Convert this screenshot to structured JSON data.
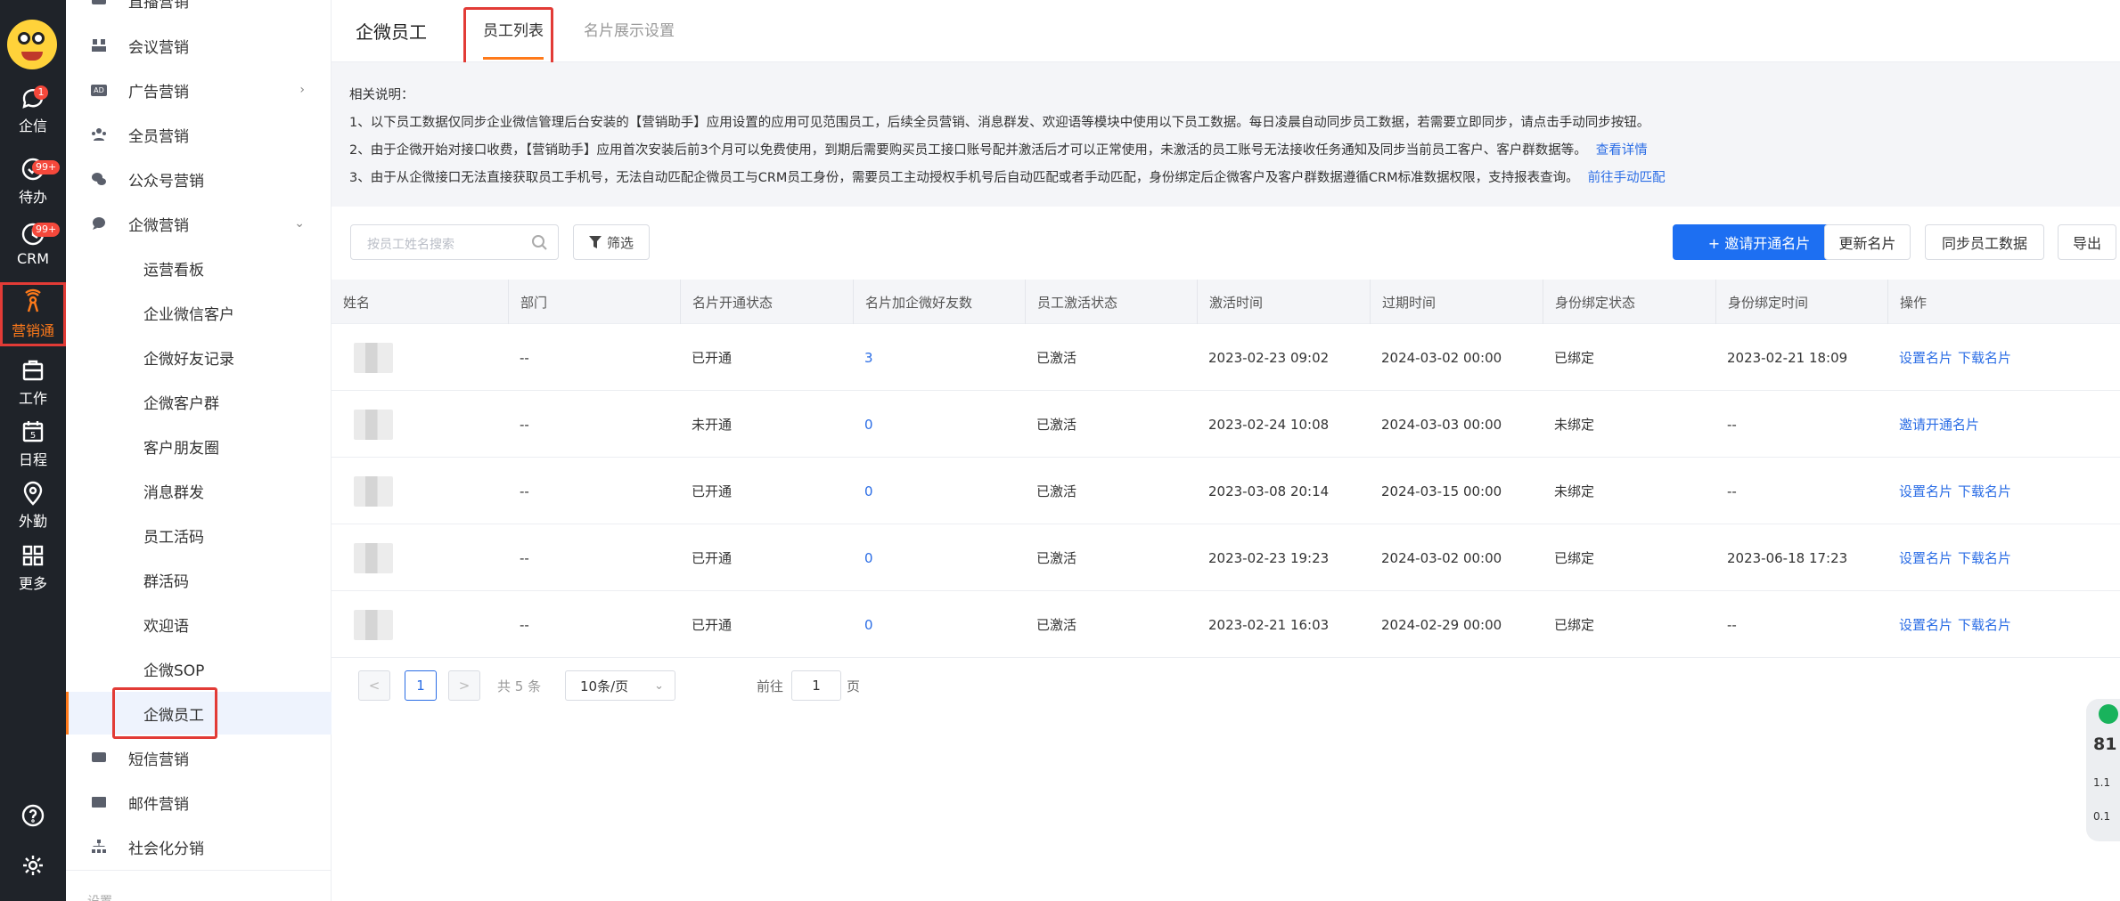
{
  "rail": {
    "items": [
      {
        "label": "企信",
        "badge": "1"
      },
      {
        "label": "待办",
        "badge": "99+"
      },
      {
        "label": "CRM",
        "badge": "99+"
      },
      {
        "label": "营销通",
        "badge": ""
      },
      {
        "label": "工作",
        "badge": ""
      },
      {
        "label": "日程",
        "badge": ""
      },
      {
        "label": "外勤",
        "badge": ""
      },
      {
        "label": "更多",
        "badge": ""
      }
    ],
    "calendar_day": "5",
    "help_icon": "help-icon",
    "settings_icon": "settings-icon"
  },
  "menu": {
    "items": [
      {
        "label": "直播营销"
      },
      {
        "label": "会议营销"
      },
      {
        "label": "广告营销"
      },
      {
        "label": "全员营销"
      },
      {
        "label": "公众号营销"
      },
      {
        "label": "企微营销"
      },
      {
        "label": "运营看板"
      },
      {
        "label": "企业微信客户"
      },
      {
        "label": "企微好友记录"
      },
      {
        "label": "企微客户群"
      },
      {
        "label": "客户朋友圈"
      },
      {
        "label": "消息群发"
      },
      {
        "label": "员工活码"
      },
      {
        "label": "群活码"
      },
      {
        "label": "欢迎语"
      },
      {
        "label": "企微SOP"
      },
      {
        "label": "企微员工"
      },
      {
        "label": "短信营销"
      },
      {
        "label": "邮件营销"
      },
      {
        "label": "社会化分销"
      },
      {
        "label": "设置"
      }
    ],
    "ad_tag": "AD"
  },
  "header": {
    "title": "企微员工",
    "tabs": [
      {
        "label": "员工列表"
      },
      {
        "label": "名片展示设置"
      }
    ]
  },
  "info": {
    "heading": "相关说明：",
    "line1": "1、以下员工数据仅同步企业微信管理后台安装的【营销助手】应用设置的应用可见范围员工，后续全员营销、消息群发、欢迎语等模块中使用以下员工数据。每日凌晨自动同步员工数据，若需要立即同步，请点击手动同步按钮。",
    "line2": "2、由于企微开始对接口收费，【营销助手】应用首次安装后前3个月可以免费使用，到期后需要购买员工接口账号配并激活后才可以正常使用，未激活的员工账号无法接收任务通知及同步当前员工客户、客户群数据等。",
    "line2_link": "查看详情",
    "line3": "3、由于从企微接口无法直接获取员工手机号，无法自动匹配企微员工与CRM员工身份，需要员工主动授权手机号后自动匹配或者手动匹配，身份绑定后企微客户及客户群数据遵循CRM标准数据权限，支持报表查询。",
    "line3_link": "前往手动匹配"
  },
  "toolbar": {
    "search_placeholder": "按员工姓名搜索",
    "filter_label": "筛选",
    "invite_label": "+ 邀请开通名片",
    "update_label": "更新名片",
    "sync_label": "同步员工数据",
    "export_label": "导出"
  },
  "table": {
    "columns": [
      "姓名",
      "部门",
      "名片开通状态",
      "名片加企微好友数",
      "员工激活状态",
      "激活时间",
      "过期时间",
      "身份绑定状态",
      "身份绑定时间",
      "操作"
    ],
    "rows": [
      {
        "dept": "--",
        "card_status": "已开通",
        "friends": "3",
        "active": "已激活",
        "active_time": "2023-02-23 09:02",
        "expire_time": "2024-03-02 00:00",
        "bind_status": "已绑定",
        "bind_time": "2023-02-21 18:09",
        "ops": [
          "设置名片",
          "下载名片"
        ]
      },
      {
        "dept": "--",
        "card_status": "未开通",
        "friends": "0",
        "active": "已激活",
        "active_time": "2023-02-24 10:08",
        "expire_time": "2024-03-03 00:00",
        "bind_status": "未绑定",
        "bind_time": "--",
        "ops": [
          "邀请开通名片"
        ]
      },
      {
        "dept": "--",
        "card_status": "已开通",
        "friends": "0",
        "active": "已激活",
        "active_time": "2023-03-08 20:14",
        "expire_time": "2024-03-15 00:00",
        "bind_status": "未绑定",
        "bind_time": "--",
        "ops": [
          "设置名片",
          "下载名片"
        ]
      },
      {
        "dept": "--",
        "card_status": "已开通",
        "friends": "0",
        "active": "已激活",
        "active_time": "2023-02-23 19:23",
        "expire_time": "2024-03-02 00:00",
        "bind_status": "已绑定",
        "bind_time": "2023-06-18 17:23",
        "ops": [
          "设置名片",
          "下载名片"
        ]
      },
      {
        "dept": "--",
        "card_status": "已开通",
        "friends": "0",
        "active": "已激活",
        "active_time": "2023-02-21 16:03",
        "expire_time": "2024-02-29 00:00",
        "bind_status": "已绑定",
        "bind_time": "--",
        "ops": [
          "设置名片",
          "下载名片"
        ]
      }
    ]
  },
  "pagination": {
    "prev": "<",
    "current": "1",
    "next": ">",
    "total": "共 5 条",
    "page_size": "10条/页",
    "goto_prefix": "前往",
    "goto_value": "1",
    "goto_suffix": "页"
  },
  "widget": {
    "score": "81",
    "up": "1.1",
    "down": "0.1"
  },
  "colors": {
    "accent": "#ff7a1a",
    "primary": "#1d6ff2",
    "highlight": "#e23b36",
    "rail": "#1f2329"
  }
}
